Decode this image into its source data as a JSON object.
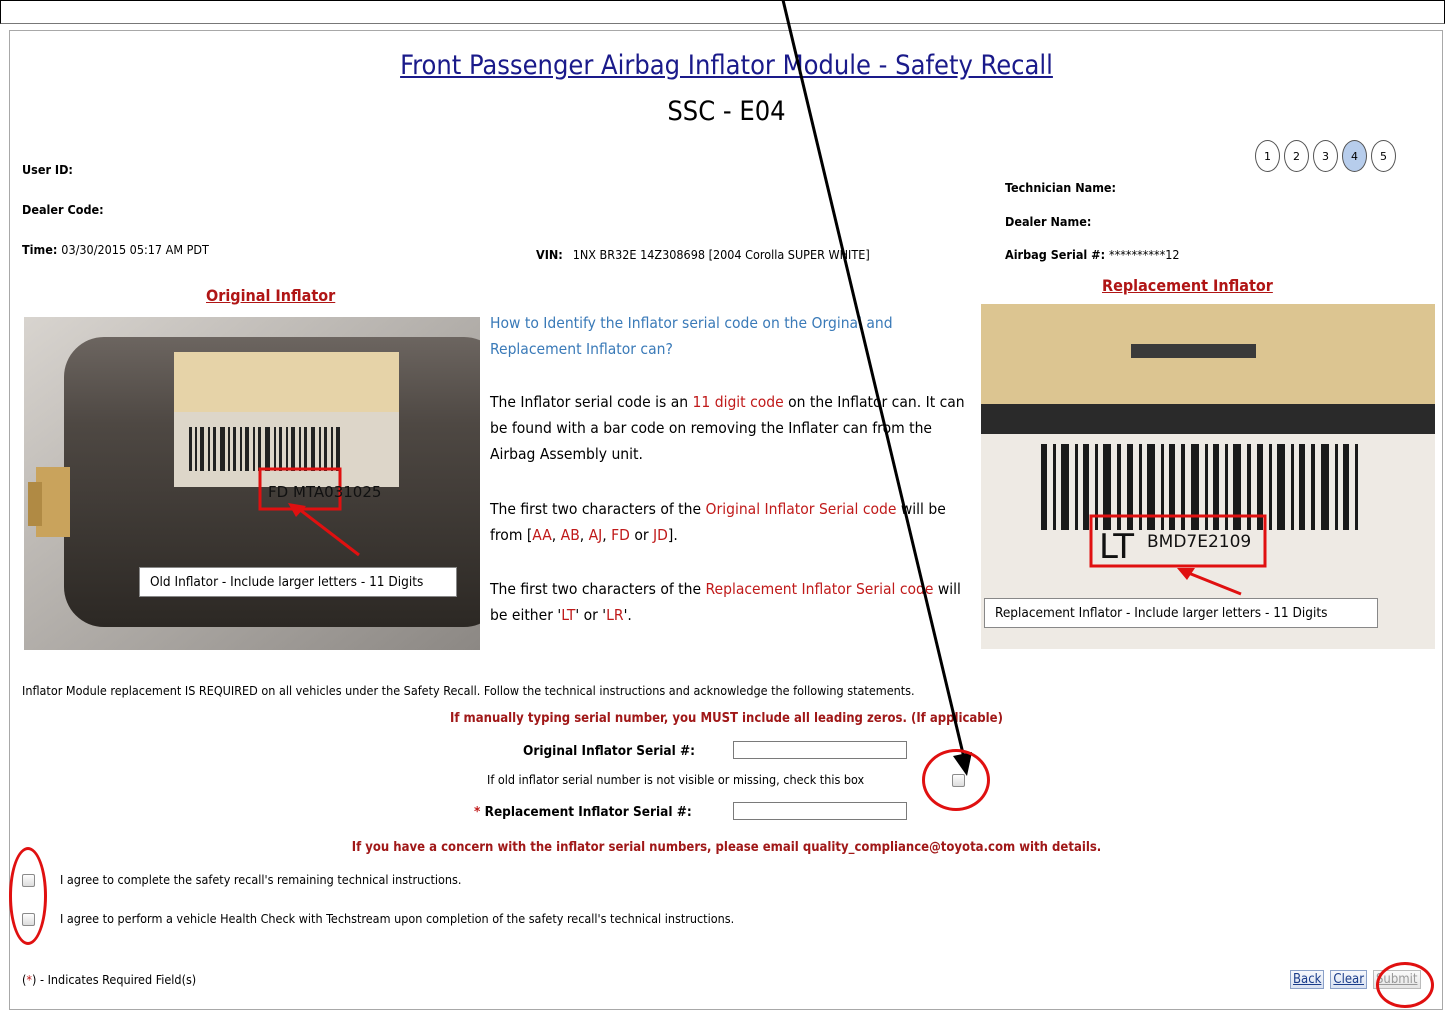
{
  "header": {
    "title": "Front Passenger Airbag Inflator Module - Safety Recall",
    "subtitle": "SSC - E04"
  },
  "steps": [
    "1",
    "2",
    "3",
    "4",
    "5"
  ],
  "active_step": "4",
  "info": {
    "user_id_label": "User ID:",
    "dealer_code_label": "Dealer Code:",
    "time_label": "Time:",
    "time_value": "03/30/2015 05:17 AM PDT",
    "vin_label": "VIN:",
    "vin_value": "1NX BR32E 14Z308698 [2004 Corolla SUPER WHITE]",
    "technician_label": "Technician Name:",
    "dealer_name_label": "Dealer Name:",
    "airbag_serial_label": "Airbag Serial #:",
    "airbag_serial_value": "**********12"
  },
  "original": {
    "heading": "Original Inflator",
    "caption": "Old Inflator - Include larger letters - 11 Digits",
    "label_code": "FD MTA031025"
  },
  "replacement": {
    "heading": "Replacement Inflator",
    "caption": "Replacement Inflator - Include larger letters - 11 Digits",
    "label_code_prefix": "LT",
    "label_code": "BMD7E2109"
  },
  "help": {
    "question": "How to Identify the Inflator serial code on the Orginal and Replacement Inflator can?",
    "p1_a": "The Inflator serial code is an ",
    "p1_b": "11 digit code",
    "p1_c": " on the Inflator can. It can be found with a bar code on removing the Inflater can from the Airbag Assembly unit.",
    "p2_a": "The first two characters of the ",
    "p2_b": "Original Inflator Serial code",
    "p2_c": " will be from [",
    "p2_codes": [
      "AA",
      "AB",
      "AJ",
      "FD",
      "JD"
    ],
    "p2_d": "].",
    "p3_a": "The first two characters of the ",
    "p3_b": "Replacement Inflator Serial code",
    "p3_c": " will be either '",
    "p3_d": "LT",
    "p3_e": "' or '",
    "p3_f": "LR",
    "p3_g": "'."
  },
  "form": {
    "instruction": "Inflator Module replacement IS REQUIRED on all vehicles under the Safety Recall. Follow the technical instructions and acknowledge the following statements.",
    "leading_zero_warning": "If manually typing serial number, you MUST include all leading zeros. (If applicable)",
    "original_label": "Original Inflator Serial #:",
    "original_value": "",
    "missing_label": "If old inflator serial number is not visible or missing, check this box",
    "replacement_required_mark": "*",
    "replacement_label": "Replacement Inflator Serial #:",
    "replacement_value": "",
    "concern": "If you have a concern with the inflator serial numbers, please email quality_compliance@toyota.com with details.",
    "agree1": "I agree to complete the safety recall's remaining technical instructions.",
    "agree2": "I agree to perform a vehicle Health Check with Techstream upon completion of the safety recall's technical instructions.",
    "required_note_a": "(",
    "required_note_star": "*",
    "required_note_b": ") - Indicates Required Field(s)"
  },
  "buttons": {
    "back": "Back",
    "clear": "Clear",
    "submit": "Submit"
  },
  "colors": {
    "annotation": "#e01010",
    "title": "#1a1a8a",
    "warning": "#a01818",
    "help_blue": "#3a7ab8",
    "active_step": "#b7cdec"
  }
}
